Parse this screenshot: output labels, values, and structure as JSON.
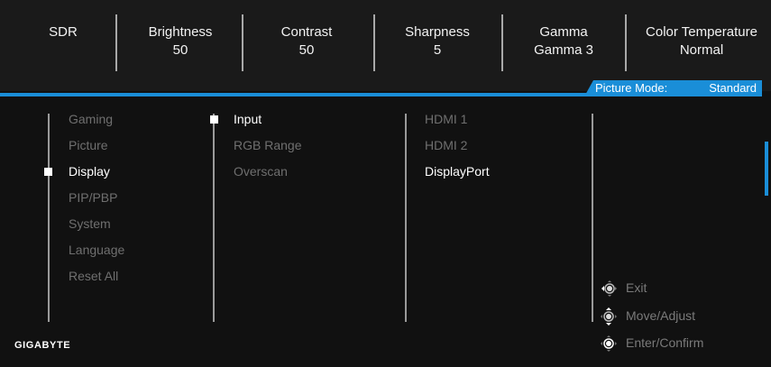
{
  "status_bar": {
    "items": [
      {
        "label": "SDR",
        "value": ""
      },
      {
        "label": "Brightness",
        "value": "50"
      },
      {
        "label": "Contrast",
        "value": "50"
      },
      {
        "label": "Sharpness",
        "value": "5"
      },
      {
        "label": "Gamma",
        "value": "Gamma 3"
      },
      {
        "label": "Color Temperature",
        "value": "Normal"
      }
    ]
  },
  "picture_mode": {
    "label": "Picture Mode:",
    "value": "Standard"
  },
  "main_menu": {
    "items": [
      "Gaming",
      "Picture",
      "Display",
      "PIP/PBP",
      "System",
      "Language",
      "Reset All"
    ],
    "active": "Display"
  },
  "sub_menu": {
    "items": [
      "Input",
      "RGB Range",
      "Overscan"
    ],
    "active": "Input"
  },
  "option_menu": {
    "items": [
      "HDMI 1",
      "HDMI 2",
      "DisplayPort"
    ],
    "active": "DisplayPort"
  },
  "key_guide": {
    "items": [
      {
        "icon": "joystick-left-icon",
        "label": "Exit"
      },
      {
        "icon": "joystick-updown-icon",
        "label": "Move/Adjust"
      },
      {
        "icon": "joystick-press-icon",
        "label": "Enter/Confirm"
      }
    ]
  },
  "brand": "GIGABYTE",
  "colors": {
    "accent": "#1a8ed8",
    "panel": "#1a1a1a",
    "inactive_text": "#6f6f6f"
  }
}
